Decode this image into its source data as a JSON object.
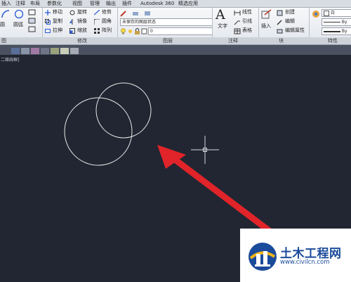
{
  "menu_tabs": [
    {
      "label": "插入"
    },
    {
      "label": "注释"
    },
    {
      "label": "布局"
    },
    {
      "label": "参数化"
    },
    {
      "label": "视图"
    },
    {
      "label": "管理"
    },
    {
      "label": "输出"
    },
    {
      "label": "插件"
    },
    {
      "label": "Autodesk 360"
    },
    {
      "label": "精选应用"
    }
  ],
  "ribbon": {
    "draw": {
      "arc_label": "圆",
      "circle_label": "圆弧"
    },
    "modify": {
      "move": "移动",
      "rotate": "旋转",
      "trim": "修剪",
      "copy": "复制",
      "mirror": "镜像",
      "fillet": "圆角",
      "stretch": "拉伸",
      "scale": "缩放",
      "array": "阵列"
    },
    "layer": {
      "state_value": "未保存的图层状态",
      "layer_value": "0"
    },
    "annotation": {
      "text": "文字",
      "dimension": "标注",
      "leader": "引线",
      "table": "表格",
      "linear": "线性"
    },
    "block": {
      "insert": "插入",
      "create": "创建",
      "edit": "编辑",
      "edit_attr": "编辑属性"
    },
    "properties": {
      "color_value": "白",
      "lineweight_1": "By",
      "lineweight_2": "By"
    }
  },
  "panel_titles": {
    "draw": "图",
    "modify": "修改",
    "layer": "图层",
    "annotation": "注释",
    "block": "块",
    "properties": "特性"
  },
  "view_label": "二维线框]",
  "watermark": {
    "title": "土木工程网",
    "url": "www.civilcn.com"
  },
  "colors": {
    "canvas": "#212632",
    "arrow": "#e0242a",
    "circle": "#e8e8e8",
    "brand": "#1b4b9b"
  }
}
